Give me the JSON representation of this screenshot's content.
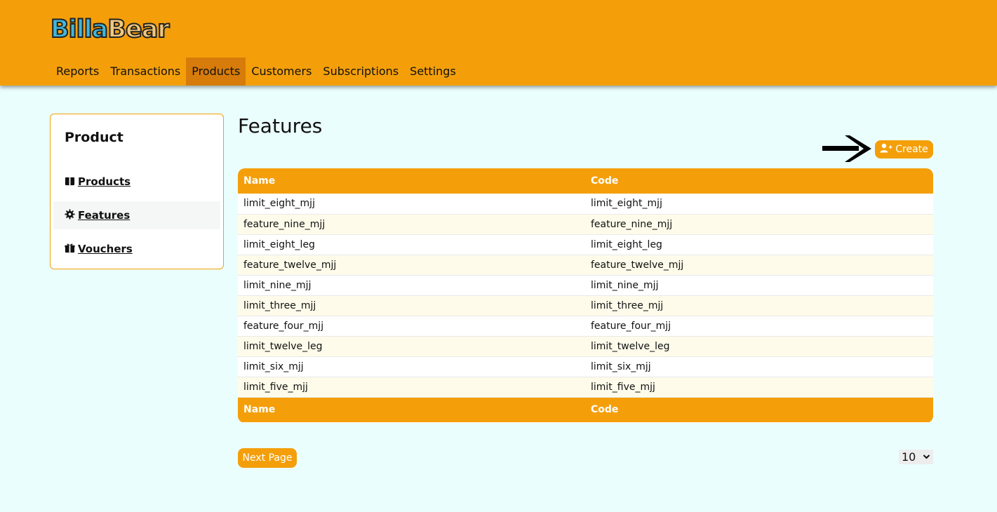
{
  "app": {
    "logo_part1": "Billa",
    "logo_part2": "Bear",
    "accent_color": "#f49f0a"
  },
  "nav": {
    "items": [
      {
        "label": "Reports"
      },
      {
        "label": "Transactions"
      },
      {
        "label": "Products",
        "active": true
      },
      {
        "label": "Customers"
      },
      {
        "label": "Subscriptions"
      },
      {
        "label": "Settings"
      }
    ]
  },
  "sidebar": {
    "title": "Product",
    "items": [
      {
        "label": "Products",
        "icon": "gift-box-icon"
      },
      {
        "label": "Features",
        "icon": "gear-icon",
        "active": true
      },
      {
        "label": "Vouchers",
        "icon": "gift-icon"
      }
    ]
  },
  "main": {
    "title": "Features",
    "create_label": "Create",
    "create_icon": "user-plus-icon",
    "table": {
      "headers": [
        "Name",
        "Code"
      ],
      "rows": [
        [
          "limit_eight_mjj",
          "limit_eight_mjj"
        ],
        [
          "feature_nine_mjj",
          "feature_nine_mjj"
        ],
        [
          "limit_eight_leg",
          "limit_eight_leg"
        ],
        [
          "feature_twelve_mjj",
          "feature_twelve_mjj"
        ],
        [
          "limit_nine_mjj",
          "limit_nine_mjj"
        ],
        [
          "limit_three_mjj",
          "limit_three_mjj"
        ],
        [
          "feature_four_mjj",
          "feature_four_mjj"
        ],
        [
          "limit_twelve_leg",
          "limit_twelve_leg"
        ],
        [
          "limit_six_mjj",
          "limit_six_mjj"
        ],
        [
          "limit_five_mjj",
          "limit_five_mjj"
        ]
      ],
      "footers": [
        "Name",
        "Code"
      ]
    },
    "next_page_label": "Next Page",
    "per_page_value": "10"
  }
}
